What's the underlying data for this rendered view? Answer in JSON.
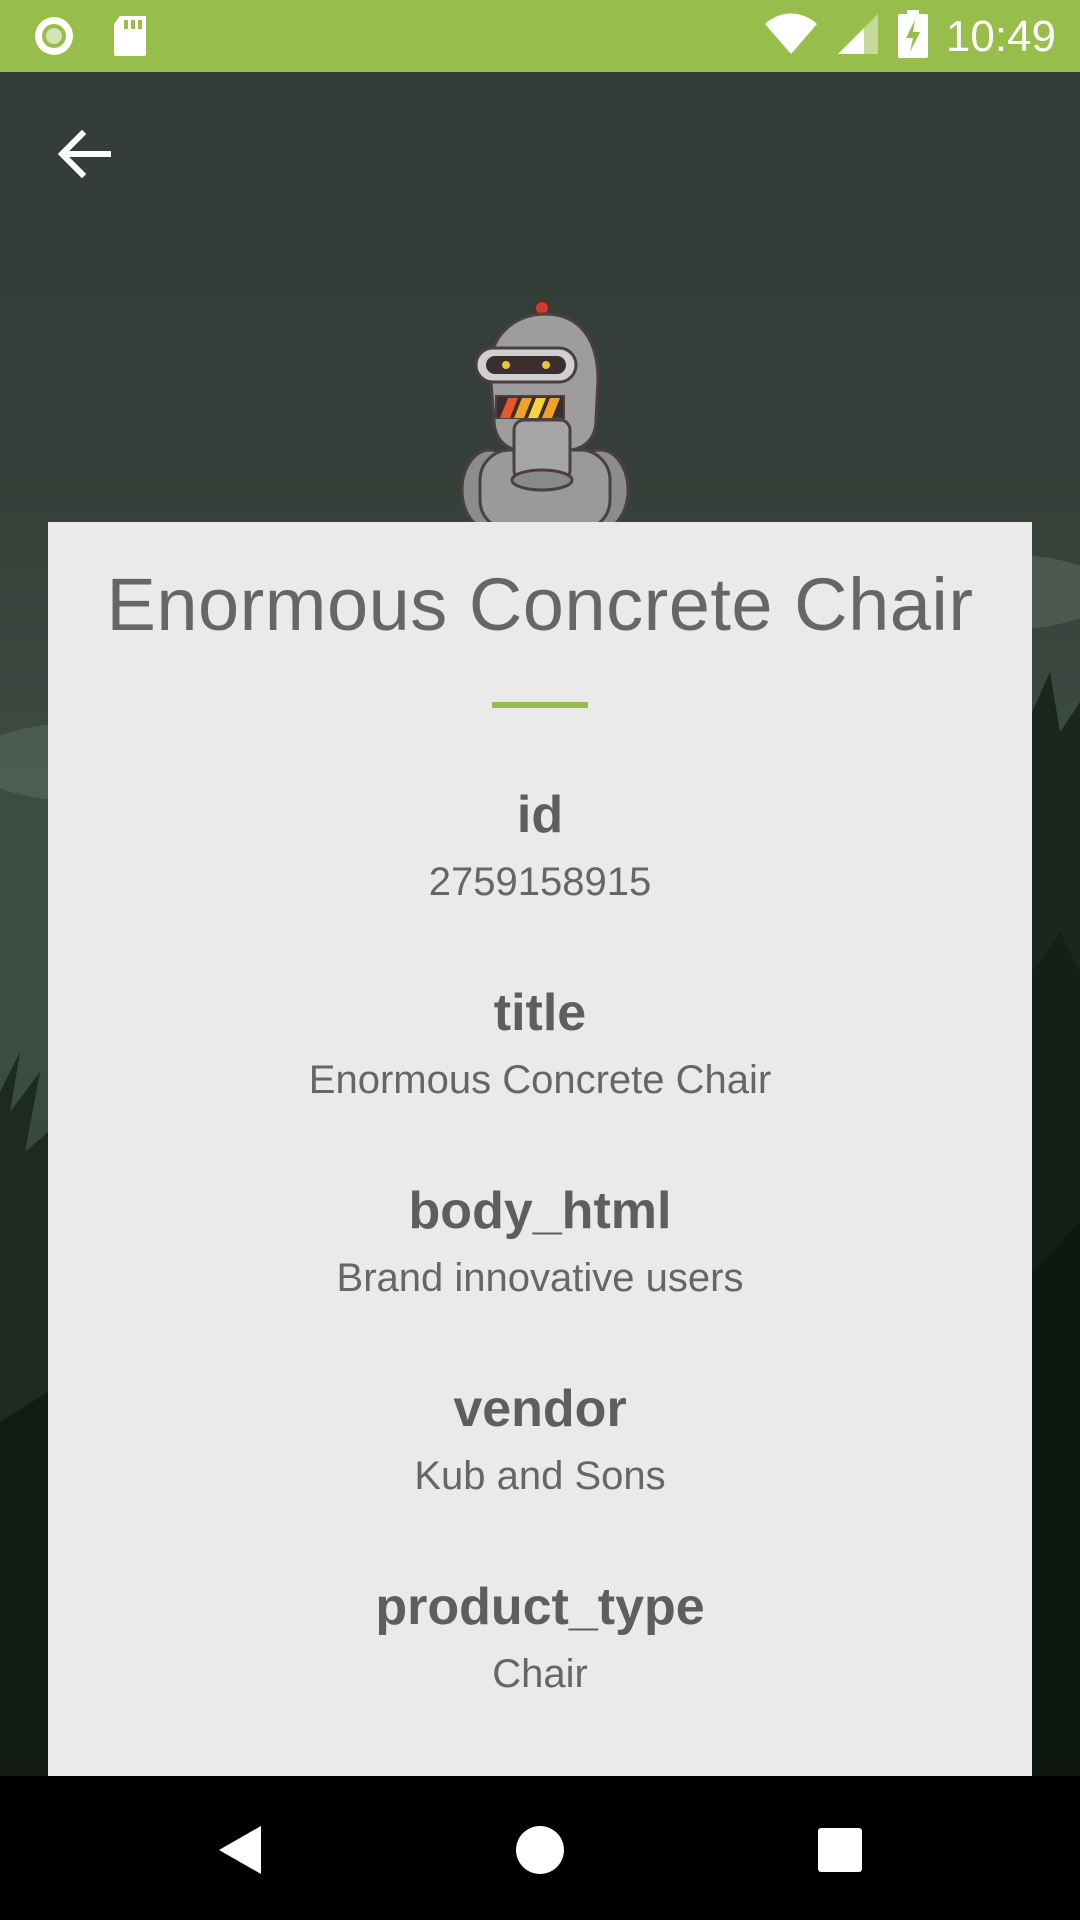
{
  "status_bar": {
    "time": "10:49",
    "icons": [
      "notification-ring-icon",
      "sd-card-icon",
      "wifi-icon",
      "signal-icon",
      "battery-charging-icon"
    ]
  },
  "header": {
    "back_icon": "arrow-back-icon"
  },
  "card": {
    "title": "Enormous Concrete Chair",
    "accent_color": "#97be4a",
    "fields": [
      {
        "name": "id",
        "value": "2759158915"
      },
      {
        "name": "title",
        "value": "Enormous Concrete Chair"
      },
      {
        "name": "body_html",
        "value": "Brand innovative users"
      },
      {
        "name": "vendor",
        "value": "Kub and Sons"
      },
      {
        "name": "product_type",
        "value": "Chair"
      }
    ]
  },
  "nav_bar": {
    "icons": [
      "nav-back-icon",
      "nav-home-icon",
      "nav-recents-icon"
    ]
  }
}
